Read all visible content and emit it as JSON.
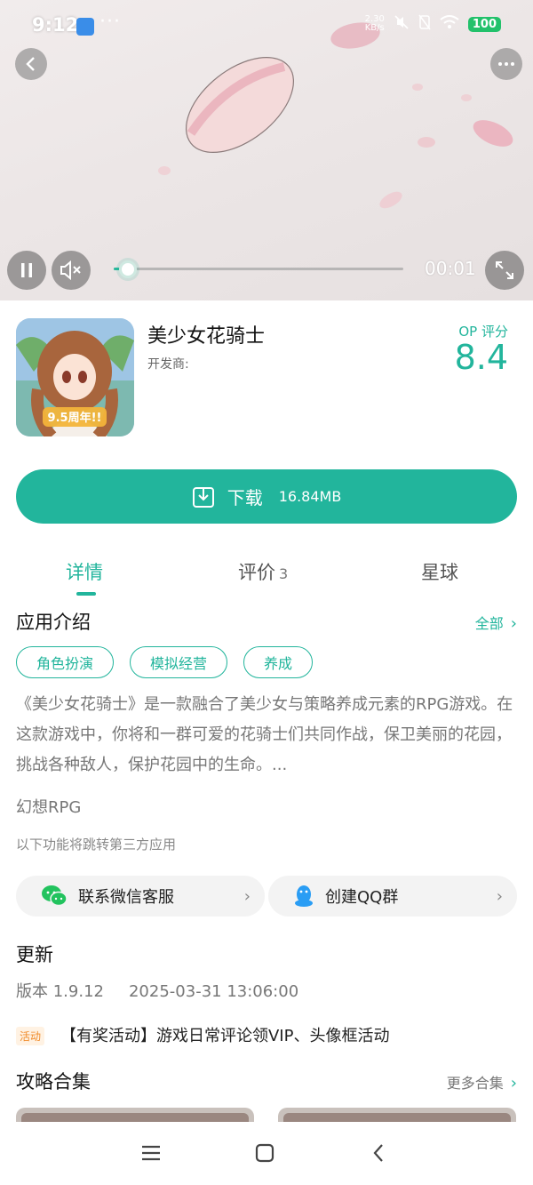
{
  "status_bar": {
    "time": "9:12",
    "dots": "···",
    "network": "2.30\nKB/s",
    "battery": "100"
  },
  "video": {
    "elapsed": "00:01",
    "progress_fraction": 0.05
  },
  "app": {
    "name": "美少女花骑士",
    "developer_label": "开发商:",
    "score_label": "OP 评分",
    "score": "8.4",
    "icon_badge": "9.5周年!!"
  },
  "download": {
    "label": "下载",
    "size": "16.84MB"
  },
  "tabs": [
    {
      "label": "详情",
      "count": "",
      "active": true
    },
    {
      "label": "评价",
      "count": "3",
      "active": false
    },
    {
      "label": "星球",
      "count": "",
      "active": false
    }
  ],
  "intro": {
    "title": "应用介绍",
    "more": "全部",
    "tags": [
      "角色扮演",
      "模拟经营",
      "养成"
    ],
    "description": "《美少女花骑士》是一款融合了美少女与策略养成元素的RPG游戏。在这款游戏中，你将和一群可爱的花骑士们共同作战，保卫美丽的花园，挑战各种敌人，保护花园中的生命。...",
    "genre": "幻想RPG",
    "third_party_note": "以下功能将跳转第三方应用"
  },
  "contacts": {
    "wechat": "联系微信客服",
    "qq": "创建QQ群"
  },
  "update": {
    "title": "更新",
    "version": "版本 1.9.12",
    "date": "2025-03-31 13:06:00",
    "activity_badge": "活动",
    "activity_text": "【有奖活动】游戏日常评论领VIP、头像框活动"
  },
  "guides": {
    "title": "攻略合集",
    "more": "更多合集"
  },
  "colors": {
    "accent": "#22b59c",
    "battery": "#23c16b",
    "activity": "#f08b2a"
  }
}
